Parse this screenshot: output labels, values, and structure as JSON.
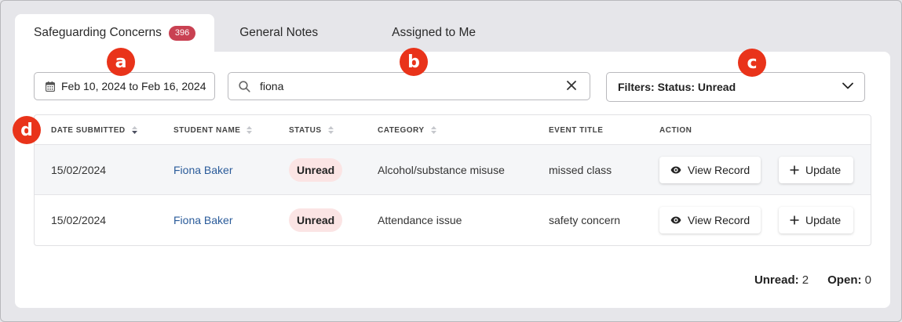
{
  "tabs": [
    {
      "label": "Safeguarding Concerns",
      "badge": "396"
    },
    {
      "label": "General Notes"
    },
    {
      "label": "Assigned to Me"
    }
  ],
  "date_range": "Feb 10, 2024 to Feb 16, 2024",
  "search": {
    "value": "fiona"
  },
  "filters": {
    "label": "Filters: Status: Unread"
  },
  "markers": [
    "a",
    "b",
    "c",
    "d"
  ],
  "table": {
    "headers": [
      "DATE SUBMITTED",
      "STUDENT NAME",
      "STATUS",
      "CATEGORY",
      "EVENT TITLE",
      "ACTION"
    ],
    "rows": [
      {
        "date": "15/02/2024",
        "student": "Fiona Baker",
        "status": "Unread",
        "category": "Alcohol/substance misuse",
        "event": "missed class",
        "view_label": "View Record",
        "update_label": "Update"
      },
      {
        "date": "15/02/2024",
        "student": "Fiona Baker",
        "status": "Unread",
        "category": "Attendance issue",
        "event": "safety concern",
        "view_label": "View Record",
        "update_label": "Update"
      }
    ]
  },
  "summary": {
    "unread_label": "Unread:",
    "unread_value": "2",
    "open_label": "Open:",
    "open_value": "0"
  },
  "colors": {
    "badge": "#c94152",
    "marker": "#e9331a",
    "link": "#2a5b9a",
    "status_pill": "#fbe4e4"
  }
}
